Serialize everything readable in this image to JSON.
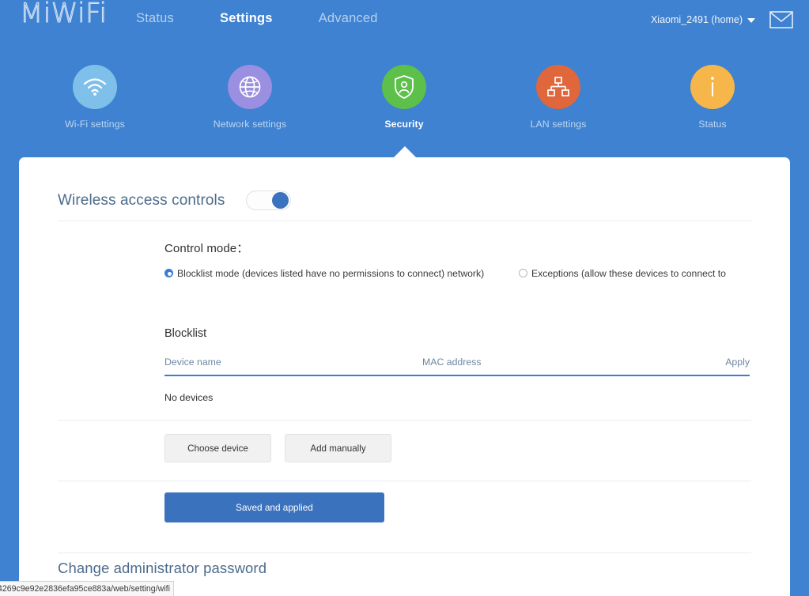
{
  "header": {
    "logo": "MiWiFi",
    "nav": [
      {
        "label": "Status",
        "active": false
      },
      {
        "label": "Settings",
        "active": true
      },
      {
        "label": "Advanced",
        "active": false
      }
    ],
    "account_label": "Xiaomi_2491 (home)",
    "caret_icon": "chevron-down-icon",
    "mail_icon": "mail-icon"
  },
  "icon_nav": [
    {
      "label": "Wi-Fi settings",
      "icon": "wifi-icon",
      "color": "#7fc0ea",
      "active": false
    },
    {
      "label": "Network settings",
      "icon": "globe-icon",
      "color": "#9a8fe0",
      "active": false
    },
    {
      "label": "Security",
      "icon": "shield-person-icon",
      "color": "#5cc04a",
      "active": true
    },
    {
      "label": "LAN settings",
      "icon": "network-topology-icon",
      "color": "#e0663c",
      "active": false
    },
    {
      "label": "Status",
      "icon": "info-icon",
      "color": "#f6b64a",
      "active": false
    }
  ],
  "section": {
    "title": "Wireless access controls",
    "toggle_state": "on",
    "control_mode_label": "Control mode：",
    "options": [
      {
        "label": "Blocklist mode (devices listed have no permissions to connect) network)",
        "selected": true
      },
      {
        "label": "Exceptions (allow these devices to connect to",
        "selected": false
      }
    ],
    "blocklist_title": "Blocklist",
    "table": {
      "columns": [
        "Device name",
        "MAC address",
        "Apply"
      ],
      "rows": [],
      "empty_text": "No devices"
    },
    "buttons": {
      "choose_device": "Choose device",
      "add_manually": "Add manually",
      "save": "Saved and applied"
    }
  },
  "change_password_title": "Change administrator password",
  "status_bar": {
    "url": "4269c9e92e2836efa95ce883a/web/setting/wifi"
  },
  "colors": {
    "background_blue": "#3e82d1",
    "accent_blue": "#3a72bd",
    "card_white": "#ffffff",
    "heading_blue_gray": "#4d6b8c"
  }
}
